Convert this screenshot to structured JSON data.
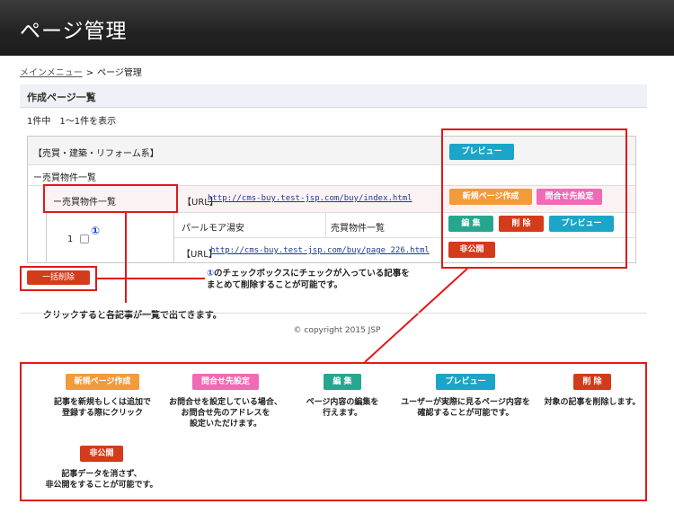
{
  "header": {
    "title": "ページ管理"
  },
  "breadcrumb": {
    "link": "メインメニュー",
    "sep": ">",
    "current": "ページ管理"
  },
  "section": {
    "title": "作成ページ一覧"
  },
  "count": "1件中　1〜1件を表示",
  "tree": {
    "root": "【売買・建築・リフォーム系】",
    "level1": "ー売買物件一覧",
    "level2": "ー売買物件一覧",
    "url_label": "【URL】",
    "url1": "http://cms-buy.test-jsp.com/buy/index.html",
    "row_number": "1",
    "circle_one": "①",
    "page_name": "パールモア湯安",
    "page_category": "売買物件一覧",
    "url2_label": "【URL】",
    "url2": "http://cms-buy.test-jsp.com/buy/page_226.html"
  },
  "buttons": {
    "preview": "プレビュー",
    "new_page": "新規ページ作成",
    "contact": "問合せ先設定",
    "edit": "編 集",
    "delete": "削 除",
    "private": "非公開",
    "bulk_delete": "一括削除"
  },
  "notes": {
    "checkbox_note_mark": "①",
    "checkbox_note_line1": "のチェックボックスにチェックが入っている記事を",
    "checkbox_note_line2": "まとめて削除することが可能です。",
    "click_note": "クリックすると各記事が一覧で出てきます。"
  },
  "footer": {
    "copyright": "© copyright 2015 JSP"
  },
  "legend": [
    {
      "label": "新規ページ作成",
      "desc1": "記事を新規もしくは追加で",
      "desc2": "登録する際にクリック",
      "desc3": ""
    },
    {
      "label": "問合せ先設定",
      "desc1": "お問合せを設定している場合、",
      "desc2": "お問合せ先のアドレスを",
      "desc3": "設定いただけます。"
    },
    {
      "label": "編 集",
      "desc1": "ページ内容の編集を",
      "desc2": "行えます。",
      "desc3": ""
    },
    {
      "label": "プレビュー",
      "desc1": "ユーザーが実際に見るページ内容を",
      "desc2": "確認することが可能です。",
      "desc3": ""
    },
    {
      "label": "削 除",
      "desc1": "対象の記事を削除します。",
      "desc2": "",
      "desc3": ""
    },
    {
      "label": "非公開",
      "desc1": "記事データを消さず、",
      "desc2": "非公開をすることが可能です。",
      "desc3": ""
    }
  ],
  "colors": {
    "preview": "#1ba5c8",
    "new_page": "#f39a3a",
    "contact": "#f06ab6",
    "edit": "#27a68f",
    "delete": "#d43b1a",
    "highlight": "#e01919"
  }
}
